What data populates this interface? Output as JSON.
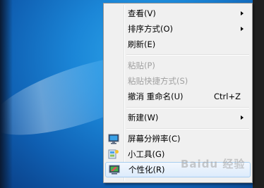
{
  "context_menu": {
    "items": [
      {
        "label": "查看(V)",
        "has_submenu": true
      },
      {
        "label": "排序方式(O)",
        "has_submenu": true
      },
      {
        "label": "刷新(E)"
      },
      {
        "label": "粘贴(P)",
        "disabled": true
      },
      {
        "label": "粘贴快捷方式(S)",
        "disabled": true
      },
      {
        "label": "撤消 重命名(U)",
        "shortcut": "Ctrl+Z"
      },
      {
        "label": "新建(W)",
        "has_submenu": true
      },
      {
        "label": "屏幕分辨率(C)",
        "icon": "display-icon"
      },
      {
        "label": "小工具(G)",
        "icon": "gadgets-icon"
      },
      {
        "label": "个性化(R)",
        "icon": "personalize-icon"
      }
    ]
  },
  "watermark": "Baidu 经验",
  "colors": {
    "menu_bg": "#f0f0f0",
    "hover_border": "#a7cdf0",
    "desktop": "#1b86d7"
  }
}
